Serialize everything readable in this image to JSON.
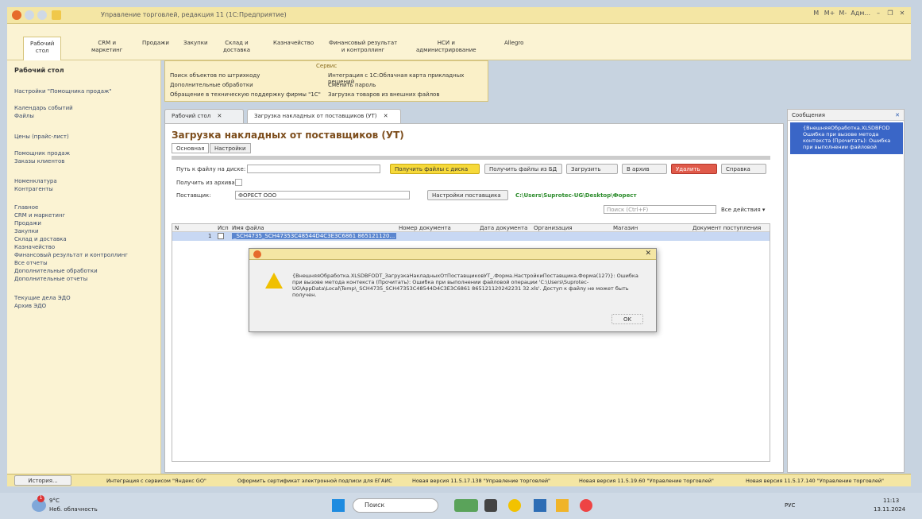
{
  "window": {
    "title": "Управление торговлей, редакция 11 (1С:Предприятие)",
    "right_labels": [
      "M",
      "M+",
      "M-",
      "Адм..."
    ]
  },
  "sections": [
    {
      "label": "Рабочий\nстол",
      "active": true
    },
    {
      "label": "CRM и\nмаркетинг"
    },
    {
      "label": "Продажи"
    },
    {
      "label": "Закупки"
    },
    {
      "label": "Склад и\nдоставка"
    },
    {
      "label": "Казначейство"
    },
    {
      "label": "Финансовый результат\nи контроллинг"
    },
    {
      "label": "НСИ и\nадминистрирование"
    },
    {
      "label": "Allegro"
    }
  ],
  "left_panel": {
    "title": "Рабочий стол",
    "items": [
      "Настройки \"Помощника продаж\"",
      "Календарь событий",
      "Файлы",
      "Цены (прайс-лист)",
      "Помощник продаж",
      "Заказы клиентов",
      "Номенклатура",
      "Контрагенты",
      "Главное",
      "CRM и маркетинг",
      "Продажи",
      "Закупки",
      "Склад и доставка",
      "Казначейство",
      "Финансовый результат и контроллинг",
      "Все отчеты",
      "Дополнительные обработки",
      "Дополнительные отчеты",
      "Текущие дела ЭДО",
      "Архив ЭДО"
    ]
  },
  "service": {
    "title": "Сервис",
    "left": [
      "Поиск объектов по штрихкоду",
      "Дополнительные обработки",
      "Обращение в техническую поддержку фирмы \"1С\""
    ],
    "right": [
      "Интеграция с 1С:Облачная карта прикладных решений",
      "Сменить пароль",
      "Загрузка товаров из внешних файлов"
    ]
  },
  "tabs": [
    "Рабочий стол",
    "Загрузка накладных от поставщиков (УТ)"
  ],
  "form": {
    "title": "Загрузка накладных от поставщиков (УТ)",
    "subtabs": [
      "Основная",
      "Настройки"
    ],
    "path_label": "Путь к файлу на диске:",
    "get_files_disk": "Получить файлы с диска",
    "get_files_db": "Получить файлы из БД",
    "load": "Загрузить",
    "archive": "В архив",
    "delete": "Удалить",
    "help": "Справка",
    "from_archive": "Получить из архива:",
    "supplier_label": "Поставщик:",
    "supplier_value": "ФОРЕСТ ООО",
    "supplier_settings": "Настройки поставщика",
    "path_value": "C:\\Users\\Suprotec-UG\\Desktop\\Форест",
    "search_placeholder": "Поиск (Ctrl+F)",
    "all_actions": "Все действия ▾",
    "columns": [
      "N",
      "Исп",
      "Имя файла",
      "Номер документа",
      "Дата документа",
      "Организация",
      "Магазин",
      "Документ поступления"
    ],
    "row": {
      "n": "1",
      "file": "_SCH4735_SCH47353C48544D4C3E3C6861 865121120..."
    }
  },
  "messages": {
    "title": "Сообщения",
    "item": "{ВнешняяОбработка.XLSDBFOD Ошибка при вызове метода контекста (Прочитать): Ошибка при выполнении файловой"
  },
  "dialog": {
    "text": "{ВнешняяОбработка.XLSDBFODT_ЗагрузкаНакладныхОтПоставщиковУТ_.Форма.НастройкиПоставщика.Форма(127)}: Ошибка при вызове метода контекста (Прочитать): Ошибка при выполнении файловой операции 'C:\\Users\\Suprotec-UG\\AppData\\Local\\Temp\\_SCH4735_SCH47353C48544D4C3E3C6861 865121120242231 32.xls'. Доступ к файлу не может быть получен.",
    "ok": "OK"
  },
  "statusbar": {
    "history": "История...",
    "items": [
      "Интеграция с сервисом \"Яндекс GO\"",
      "Оформить сертификат электронной подписи для ЕГАИС",
      "Новая версия 11.5.17.138 \"Управление торговлей\"",
      "Новая версия 11.5.19.60 \"Управление торговлей\"",
      "Новая версия 11.5.17.140 \"Управление торговлей\""
    ]
  },
  "taskbar": {
    "temp": "9°C",
    "weather": "Неб. облачность",
    "search": "Поиск",
    "lang": "РУС",
    "time": "11:13",
    "date": "13.11.2024",
    "badge": "1"
  }
}
